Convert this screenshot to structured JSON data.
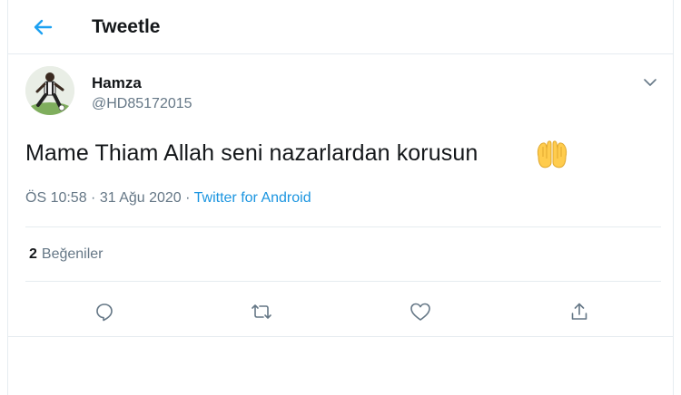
{
  "header": {
    "title": "Tweetle",
    "back_icon": "arrow-left-icon"
  },
  "tweet": {
    "display_name": "Hamza",
    "handle": "@HD85172015",
    "text": "Mame Thiam Allah seni nazarlardan korusun",
    "emoji": "palms-up-together-emoji",
    "time": "ÖS 10:58",
    "separator": " · ",
    "date": "31 Ağu 2020",
    "source": "Twitter for Android",
    "likes_count": "2",
    "likes_label": "Beğeniler"
  },
  "actions": [
    {
      "name": "reply",
      "icon": "comment-icon"
    },
    {
      "name": "retweet",
      "icon": "retweet-icon"
    },
    {
      "name": "like",
      "icon": "heart-icon"
    },
    {
      "name": "share",
      "icon": "share-icon"
    }
  ],
  "colors": {
    "accent": "#1da1f2",
    "link": "#1b95e0",
    "text_primary": "#14171a",
    "text_secondary": "#657786",
    "border": "#e6ecf0"
  }
}
